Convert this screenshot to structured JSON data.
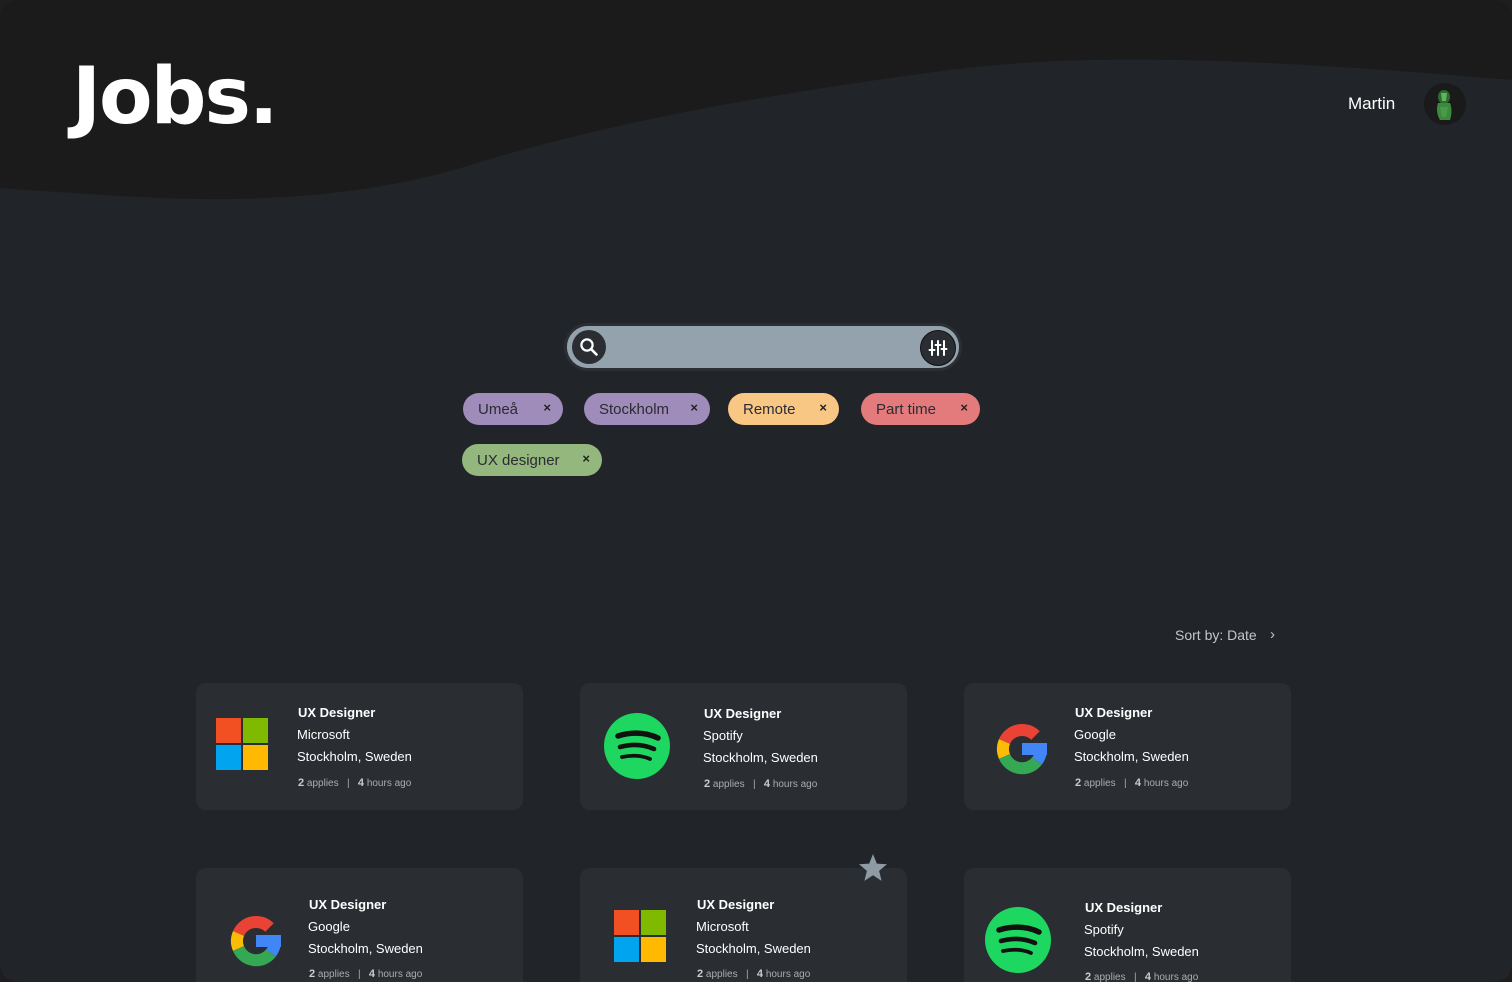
{
  "app": {
    "logo_text": "Jobs."
  },
  "user": {
    "name": "Martin"
  },
  "search": {
    "value": "",
    "placeholder": ""
  },
  "filters": [
    {
      "label": "Umeå",
      "color": "#9f8cba"
    },
    {
      "label": "Stockholm",
      "color": "#9f8cba"
    },
    {
      "label": "Remote",
      "color": "#f9c784"
    },
    {
      "label": "Part time",
      "color": "#e37b7c"
    },
    {
      "label": "UX designer",
      "color": "#93b77d"
    }
  ],
  "remove_label": "×",
  "sort": {
    "label": "Sort by: Date",
    "chevron": "›"
  },
  "jobs": [
    {
      "title": "UX Designer",
      "company": "Microsoft",
      "location": "Stockholm, Sweden",
      "applies": "2",
      "applies_label": "applies",
      "separator": "|",
      "time": "4",
      "time_label": "hours ago",
      "logo": "microsoft-logo"
    },
    {
      "title": "UX Designer",
      "company": "Spotify",
      "location": "Stockholm, Sweden",
      "applies": "2",
      "applies_label": "applies",
      "separator": "|",
      "time": "4",
      "time_label": "hours ago",
      "logo": "spotify-logo"
    },
    {
      "title": "UX Designer",
      "company": "Google",
      "location": "Stockholm, Sweden",
      "applies": "2",
      "applies_label": "applies",
      "separator": "|",
      "time": "4",
      "time_label": "hours ago",
      "logo": "google-logo"
    },
    {
      "title": "UX Designer",
      "company": "Google",
      "location": "Stockholm, Sweden",
      "applies": "2",
      "applies_label": "applies",
      "separator": "|",
      "time": "4",
      "time_label": "hours ago",
      "logo": "google-logo"
    },
    {
      "title": "UX Designer",
      "company": "Microsoft",
      "location": "Stockholm, Sweden",
      "applies": "2",
      "applies_label": "applies",
      "separator": "|",
      "time": "4",
      "time_label": "hours ago",
      "logo": "microsoft-logo",
      "starred": true
    },
    {
      "title": "UX Designer",
      "company": "Spotify",
      "location": "Stockholm, Sweden",
      "applies": "2",
      "applies_label": "applies",
      "separator": "|",
      "time": "4",
      "time_label": "hours ago",
      "logo": "spotify-logo"
    }
  ],
  "colors": {
    "background": "#212428",
    "header": "#1b1b1b",
    "card": "#2a2d32",
    "search_field": "#93a2ad",
    "star": "#8e9aa4"
  },
  "icons": [
    "search-icon",
    "filter-sliders-icon",
    "remove-icon",
    "chevron-right-icon",
    "star-icon",
    "avatar"
  ]
}
